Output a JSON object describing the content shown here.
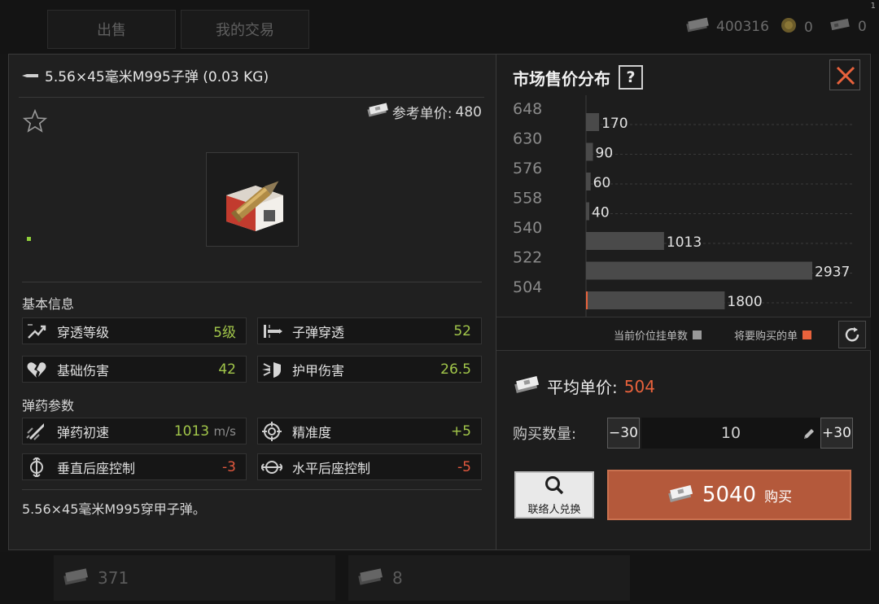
{
  "background": {
    "tabs": [
      "出售",
      "我的交易"
    ],
    "currency": [
      {
        "icon": "cash-stack-icon",
        "value": "400316"
      },
      {
        "icon": "coin-icon",
        "value": "0"
      },
      {
        "icon": "ticket-icon",
        "value": "0"
      }
    ],
    "bottom_slots": [
      {
        "icon": "cash-stack-icon",
        "value": "371"
      },
      {
        "icon": "cash-stack-icon",
        "value": "8"
      }
    ],
    "corner_mark": "1"
  },
  "item": {
    "title": "5.56×45毫米M995子弹 (0.03 KG)",
    "ref_price_label": "参考单价:",
    "ref_price": "480",
    "description": "5.56×45毫米M995穿甲子弹。"
  },
  "sections": {
    "basic": "基本信息",
    "ammo": "弹药参数"
  },
  "stats": [
    {
      "label": "穿透等级",
      "value": "5级",
      "tone": "green",
      "icon": "penetration-level-icon"
    },
    {
      "label": "子弹穿透",
      "value": "52",
      "tone": "green",
      "icon": "bullet-penetration-icon"
    },
    {
      "label": "基础伤害",
      "value": "42",
      "tone": "green",
      "icon": "broken-heart-icon"
    },
    {
      "label": "护甲伤害",
      "value": "26.5",
      "tone": "green",
      "icon": "armor-damage-icon"
    },
    {
      "label": "弹药初速",
      "value": "1013",
      "unit": "m/s",
      "tone": "green",
      "icon": "muzzle-velocity-icon"
    },
    {
      "label": "精准度",
      "value": "+5",
      "tone": "green",
      "icon": "crosshair-icon"
    },
    {
      "label": "垂直后座控制",
      "value": "-3",
      "tone": "red",
      "icon": "vertical-recoil-icon"
    },
    {
      "label": "水平后座控制",
      "value": "-5",
      "tone": "red",
      "icon": "horizontal-recoil-icon"
    }
  ],
  "market": {
    "title": "市场售价分布",
    "help": "?",
    "legend": {
      "current": "当前价位挂单数",
      "buy": "将要购买的单"
    },
    "avg_label": "平均单价:",
    "avg_value": "504",
    "qty_label": "购买数量:",
    "qty_minus": "−30",
    "qty_value": "10",
    "qty_plus": "+30",
    "contact_label": "联络人兑换",
    "buy_price": "5040",
    "buy_label": "购买",
    "colors": {
      "accent": "#e8623c",
      "bar": "#4a4a4a",
      "buy": "#b4593b"
    }
  },
  "chart_data": {
    "type": "bar",
    "orientation": "horizontal",
    "categories": [
      "648",
      "630",
      "576",
      "558",
      "540",
      "522",
      "504"
    ],
    "values": [
      170,
      90,
      60,
      40,
      1013,
      2937,
      1800
    ],
    "grid": true
  }
}
